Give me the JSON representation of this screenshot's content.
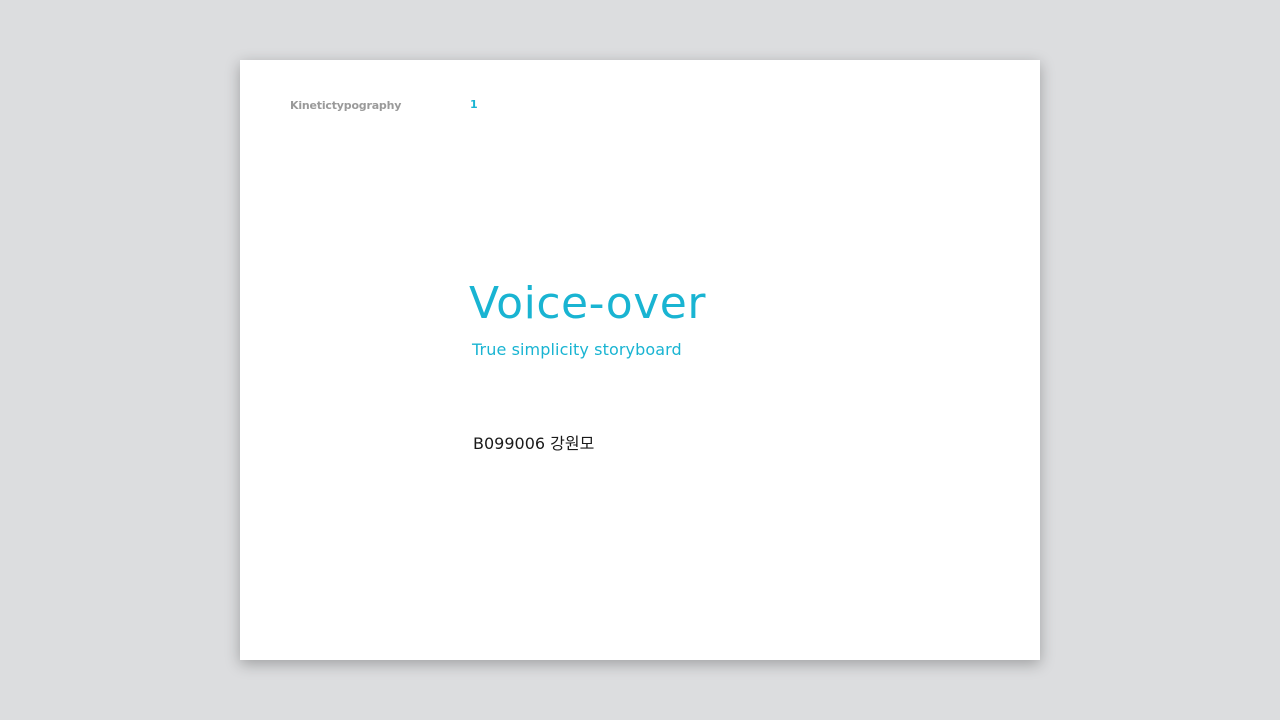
{
  "slide": {
    "header_title": "Kinetictypography",
    "page_number": "1",
    "title": "Voice-over",
    "subtitle": "True simplicity storyboard",
    "author": "B099006 강원모"
  },
  "colors": {
    "accent": "#19b4d2",
    "header_text": "#9a9a9a",
    "body_text": "#1a1a1a",
    "background": "#dcdddf",
    "page": "#ffffff"
  }
}
